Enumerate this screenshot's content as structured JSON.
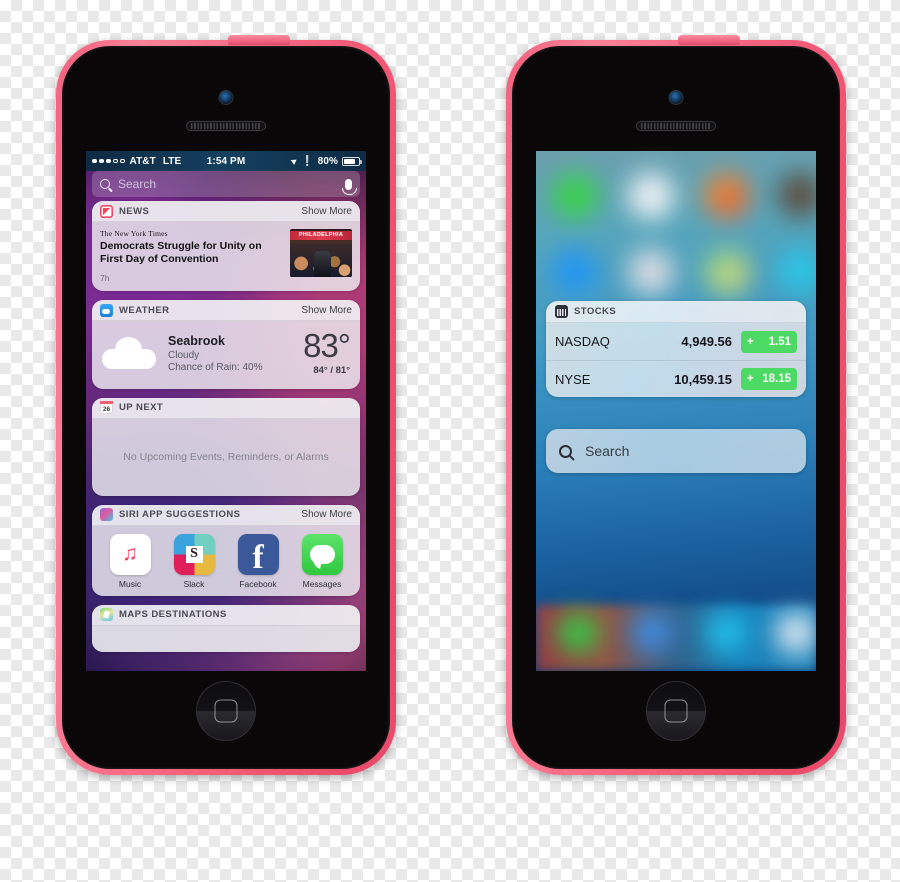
{
  "left_phone": {
    "device_name": "iPhone 5c",
    "status_bar": {
      "carrier": "AT&T",
      "network": "LTE",
      "time": "1:54 PM",
      "battery_percent": "80%",
      "location_icon": "location-arrow-icon",
      "bluetooth_icon": "bluetooth-icon"
    },
    "search": {
      "placeholder": "Search",
      "mic_icon": "microphone-icon",
      "search_icon": "search-icon"
    },
    "widgets": {
      "news": {
        "title": "NEWS",
        "show_more": "Show More",
        "icon": "news-app-icon",
        "source": "The New York Times",
        "headline": "Democrats Struggle for Unity on First Day of Convention",
        "age": "7h",
        "thumb_banner": "PHILADELPHIA"
      },
      "weather": {
        "title": "WEATHER",
        "show_more": "Show More",
        "icon": "weather-app-icon",
        "city": "Seabrook",
        "condition": "Cloudy",
        "rain": "Chance of Rain: 40%",
        "temp": "83°",
        "high_low": "84° / 81°"
      },
      "up_next": {
        "title": "UP NEXT",
        "icon": "calendar-icon",
        "calendar_day": "26",
        "empty_text": "No Upcoming Events, Reminders, or Alarms"
      },
      "siri": {
        "title": "SIRI APP SUGGESTIONS",
        "show_more": "Show More",
        "icon": "siri-icon",
        "apps": [
          {
            "label": "Music",
            "icon": "music-app-icon"
          },
          {
            "label": "Slack",
            "icon": "slack-app-icon",
            "glyph": "S"
          },
          {
            "label": "Facebook",
            "icon": "facebook-app-icon",
            "glyph": "f"
          },
          {
            "label": "Messages",
            "icon": "messages-app-icon"
          }
        ]
      },
      "maps": {
        "title": "MAPS DESTINATIONS",
        "icon": "maps-app-icon"
      }
    }
  },
  "right_phone": {
    "device_name": "iPhone 5c",
    "widgets": {
      "stocks": {
        "title": "STOCKS",
        "icon": "stocks-app-icon",
        "rows": [
          {
            "name": "NASDAQ",
            "value": "4,949.56",
            "sign": "+",
            "change": "1.51"
          },
          {
            "name": "NYSE",
            "value": "10,459.15",
            "sign": "+",
            "change": "18.15"
          }
        ],
        "positive_color": "#4cd964"
      },
      "search": {
        "label": "Search",
        "search_icon": "search-icon"
      }
    }
  }
}
